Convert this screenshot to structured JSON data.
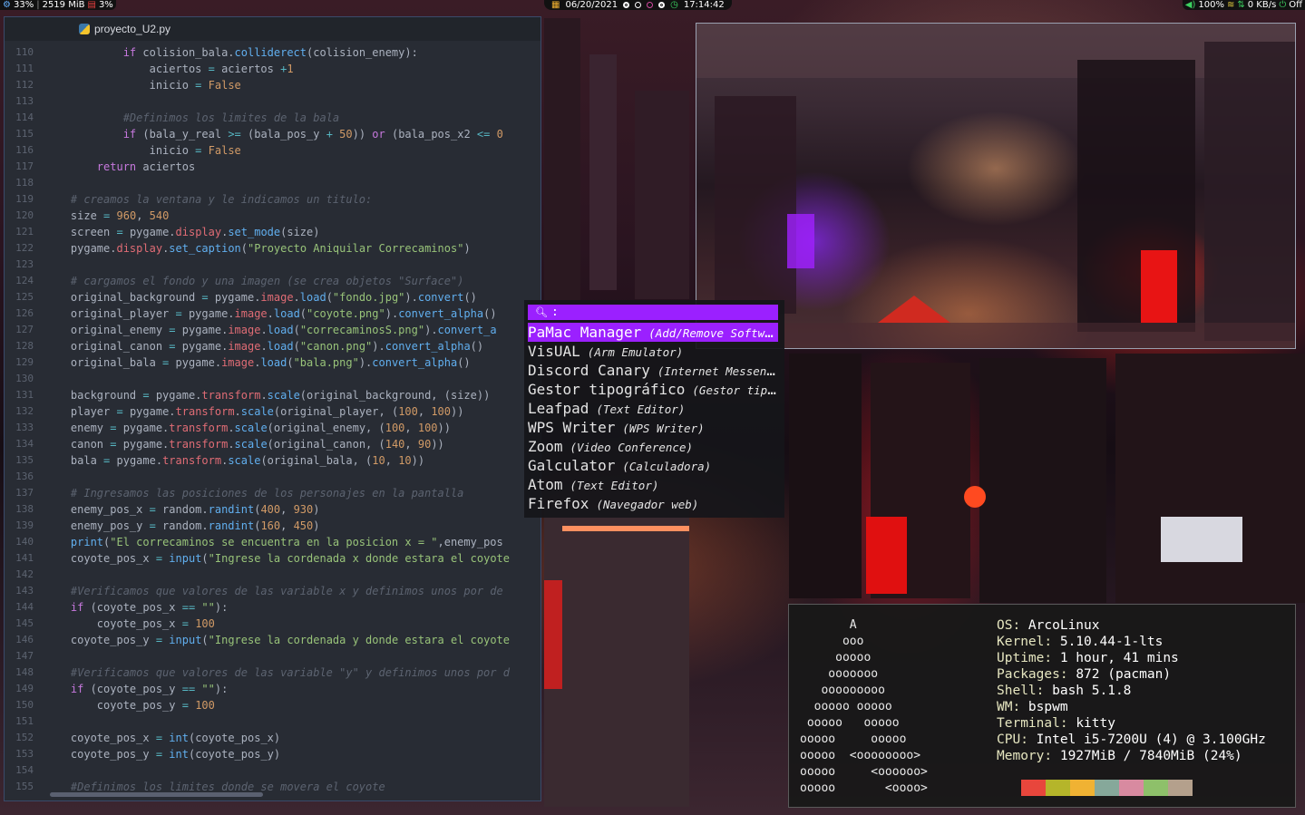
{
  "topbar": {
    "cpu": "33%",
    "mem": "2519 MiB",
    "temp": "3%",
    "date": "06/20/2021",
    "time": "17:14:42",
    "volume": "100%",
    "net": "0 KB/s",
    "power": "Off"
  },
  "editor": {
    "tab_title": "proyecto_U2.py",
    "lines": [
      {
        "n": "110",
        "html": "            <span class='k'>if</span> colision_bala.<span class='f'>colliderect</span>(colision_enemy):"
      },
      {
        "n": "111",
        "html": "                aciertos <span class='o'>=</span> aciertos <span class='o'>+</span><span class='n'>1</span>"
      },
      {
        "n": "112",
        "html": "                inicio <span class='o'>=</span> <span class='n'>False</span>"
      },
      {
        "n": "113",
        "html": ""
      },
      {
        "n": "114",
        "html": "            <span class='c'>#Definimos los limites de la bala</span>"
      },
      {
        "n": "115",
        "html": "            <span class='k'>if</span> (bala_y_real <span class='o'>&gt;=</span> (bala_pos_y <span class='o'>+</span> <span class='n'>50</span>)) <span class='k'>or</span> (bala_pos_x2 <span class='o'>&lt;=</span> <span class='n'>0</span>"
      },
      {
        "n": "116",
        "html": "                inicio <span class='o'>=</span> <span class='n'>False</span>"
      },
      {
        "n": "117",
        "html": "        <span class='k'>return</span> aciertos"
      },
      {
        "n": "118",
        "html": ""
      },
      {
        "n": "119",
        "html": "    <span class='c'># creamos la ventana y le indicamos un titulo:</span>"
      },
      {
        "n": "120",
        "html": "    size <span class='o'>=</span> <span class='n'>960</span>, <span class='n'>540</span>"
      },
      {
        "n": "121",
        "html": "    screen <span class='o'>=</span> pygame.<span class='m'>display</span>.<span class='f'>set_mode</span>(size)"
      },
      {
        "n": "122",
        "html": "    pygame.<span class='m'>display</span>.<span class='f'>set_caption</span>(<span class='s'>\"Proyecto Aniquilar Correcaminos\"</span>)"
      },
      {
        "n": "123",
        "html": ""
      },
      {
        "n": "124",
        "html": "    <span class='c'># cargamos el fondo y una imagen (se crea objetos \"Surface\")</span>"
      },
      {
        "n": "125",
        "html": "    original_background <span class='o'>=</span> pygame.<span class='m'>image</span>.<span class='f'>load</span>(<span class='s'>\"fondo.jpg\"</span>).<span class='f'>convert</span>()"
      },
      {
        "n": "126",
        "html": "    original_player <span class='o'>=</span> pygame.<span class='m'>image</span>.<span class='f'>load</span>(<span class='s'>\"coyote.png\"</span>).<span class='f'>convert_alpha</span>()"
      },
      {
        "n": "127",
        "html": "    original_enemy <span class='o'>=</span> pygame.<span class='m'>image</span>.<span class='f'>load</span>(<span class='s'>\"correcaminosS.png\"</span>).<span class='f'>convert_a</span>"
      },
      {
        "n": "128",
        "html": "    original_canon <span class='o'>=</span> pygame.<span class='m'>image</span>.<span class='f'>load</span>(<span class='s'>\"canon.png\"</span>).<span class='f'>convert_alpha</span>()"
      },
      {
        "n": "129",
        "html": "    original_bala <span class='o'>=</span> pygame.<span class='m'>image</span>.<span class='f'>load</span>(<span class='s'>\"bala.png\"</span>).<span class='f'>convert_alpha</span>()"
      },
      {
        "n": "130",
        "html": ""
      },
      {
        "n": "131",
        "html": "    background <span class='o'>=</span> pygame.<span class='m'>transform</span>.<span class='f'>scale</span>(original_background, (size))"
      },
      {
        "n": "132",
        "html": "    player <span class='o'>=</span> pygame.<span class='m'>transform</span>.<span class='f'>scale</span>(original_player, (<span class='n'>100</span>, <span class='n'>100</span>))"
      },
      {
        "n": "133",
        "html": "    enemy <span class='o'>=</span> pygame.<span class='m'>transform</span>.<span class='f'>scale</span>(original_enemy, (<span class='n'>100</span>, <span class='n'>100</span>))"
      },
      {
        "n": "134",
        "html": "    canon <span class='o'>=</span> pygame.<span class='m'>transform</span>.<span class='f'>scale</span>(original_canon, (<span class='n'>140</span>, <span class='n'>90</span>))"
      },
      {
        "n": "135",
        "html": "    bala <span class='o'>=</span> pygame.<span class='m'>transform</span>.<span class='f'>scale</span>(original_bala, (<span class='n'>10</span>, <span class='n'>10</span>))"
      },
      {
        "n": "136",
        "html": ""
      },
      {
        "n": "137",
        "html": "    <span class='c'># Ingresamos las posiciones de los personajes en la pantalla</span>"
      },
      {
        "n": "138",
        "html": "    enemy_pos_x <span class='o'>=</span> random.<span class='f'>randint</span>(<span class='n'>400</span>, <span class='n'>930</span>)"
      },
      {
        "n": "139",
        "html": "    enemy_pos_y <span class='o'>=</span> random.<span class='f'>randint</span>(<span class='n'>160</span>, <span class='n'>450</span>)"
      },
      {
        "n": "140",
        "html": "    <span class='f'>print</span>(<span class='s'>\"El correcaminos se encuentra en la posicion x = \"</span>,enemy_pos"
      },
      {
        "n": "141",
        "html": "    coyote_pos_x <span class='o'>=</span> <span class='f'>input</span>(<span class='s'>\"Ingrese la cordenada x donde estara el coyote</span>"
      },
      {
        "n": "142",
        "html": ""
      },
      {
        "n": "143",
        "html": "    <span class='c'>#Verificamos que valores de las variable x y definimos unos por de</span>"
      },
      {
        "n": "144",
        "html": "    <span class='k'>if</span> (coyote_pos_x <span class='o'>==</span> <span class='s'>\"\"</span>):"
      },
      {
        "n": "145",
        "html": "        coyote_pos_x <span class='o'>=</span> <span class='n'>100</span>"
      },
      {
        "n": "146",
        "html": "    coyote_pos_y <span class='o'>=</span> <span class='f'>input</span>(<span class='s'>\"Ingrese la cordenada y donde estara el coyote</span>"
      },
      {
        "n": "147",
        "html": ""
      },
      {
        "n": "148",
        "html": "    <span class='c'>#Verificamos que valores de las variable \"y\" y definimos unos por d</span>"
      },
      {
        "n": "149",
        "html": "    <span class='k'>if</span> (coyote_pos_y <span class='o'>==</span> <span class='s'>\"\"</span>):"
      },
      {
        "n": "150",
        "html": "        coyote_pos_y <span class='o'>=</span> <span class='n'>100</span>"
      },
      {
        "n": "151",
        "html": ""
      },
      {
        "n": "152",
        "html": "    coyote_pos_x <span class='o'>=</span> <span class='f'>int</span>(coyote_pos_x)"
      },
      {
        "n": "153",
        "html": "    coyote_pos_y <span class='o'>=</span> <span class='f'>int</span>(coyote_pos_y)"
      },
      {
        "n": "154",
        "html": ""
      },
      {
        "n": "155",
        "html": "    <span class='c'>#Definimos los limites donde se movera el coyote</span>"
      }
    ]
  },
  "launcher": {
    "prompt": ":",
    "items": [
      {
        "name": "PaMac Manager",
        "desc": "(Add/Remove Software)",
        "selected": true
      },
      {
        "name": "VisUAL",
        "desc": "(Arm Emulator)"
      },
      {
        "name": "Discord Canary",
        "desc": "(Internet Messenger)"
      },
      {
        "name": "Gestor tipográfico",
        "desc": "(Gestor tipográfico)"
      },
      {
        "name": "Leafpad",
        "desc": "(Text Editor)"
      },
      {
        "name": "WPS Writer",
        "desc": "(WPS Writer)"
      },
      {
        "name": "Zoom",
        "desc": "(Video Conference)"
      },
      {
        "name": "Galculator",
        "desc": "(Calculadora)"
      },
      {
        "name": "Atom",
        "desc": "(Text Editor)"
      },
      {
        "name": "Firefox",
        "desc": "(Navegador web)"
      }
    ]
  },
  "neofetch": {
    "logo": "       A\n      ooo\n     ooooo\n    ooooooo\n   ooooooooo\n  ooooo ooooo\n ooooo   ooooo\nooooo     ooooo\nooooo  <oooooooo>\nooooo     <oooooo>\nooooo       <oooo>",
    "rows": [
      {
        "key": "OS: ",
        "val": "ArcoLinux"
      },
      {
        "key": "Kernel: ",
        "val": "5.10.44-1-lts"
      },
      {
        "key": "Uptime: ",
        "val": "1 hour, 41 mins"
      },
      {
        "key": "Packages: ",
        "val": "872 (pacman)"
      },
      {
        "key": "Shell: ",
        "val": "bash 5.1.8"
      },
      {
        "key": "WM: ",
        "val": "bspwm"
      },
      {
        "key": "Terminal: ",
        "val": "kitty"
      },
      {
        "key": "CPU: ",
        "val": "Intel i5-7200U (4) @ 3.100GHz"
      },
      {
        "key": "Memory: ",
        "val": "1927MiB / 7840MiB (24%)"
      }
    ],
    "colors": [
      "#e8463c",
      "#b5b52a",
      "#f0b233",
      "#86a89a",
      "#d88aa0",
      "#8ec06a",
      "#b4a08c"
    ]
  }
}
